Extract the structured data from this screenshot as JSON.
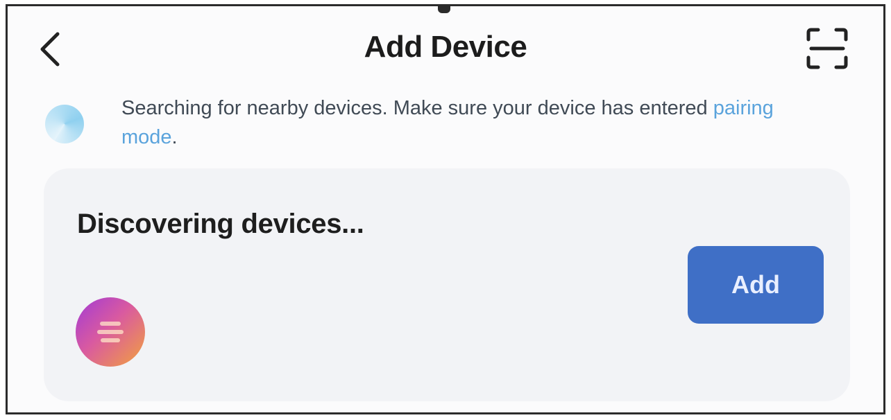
{
  "header": {
    "title": "Add Device",
    "back_icon": "chevron-left-icon",
    "scan_icon": "scan-icon"
  },
  "notice": {
    "text_before_link": "Searching for nearby devices. Make sure your device has entered ",
    "link_text": "pairing mode",
    "text_after_link": ".",
    "spinner_icon": "searching-spinner-icon"
  },
  "discovery": {
    "title": "Discovering devices...",
    "add_label": "Add",
    "device_icon": "device-avatar-icon"
  },
  "colors": {
    "accent": "#3f6fc6",
    "link": "#5aa3dc",
    "card_bg": "#f2f3f6"
  }
}
